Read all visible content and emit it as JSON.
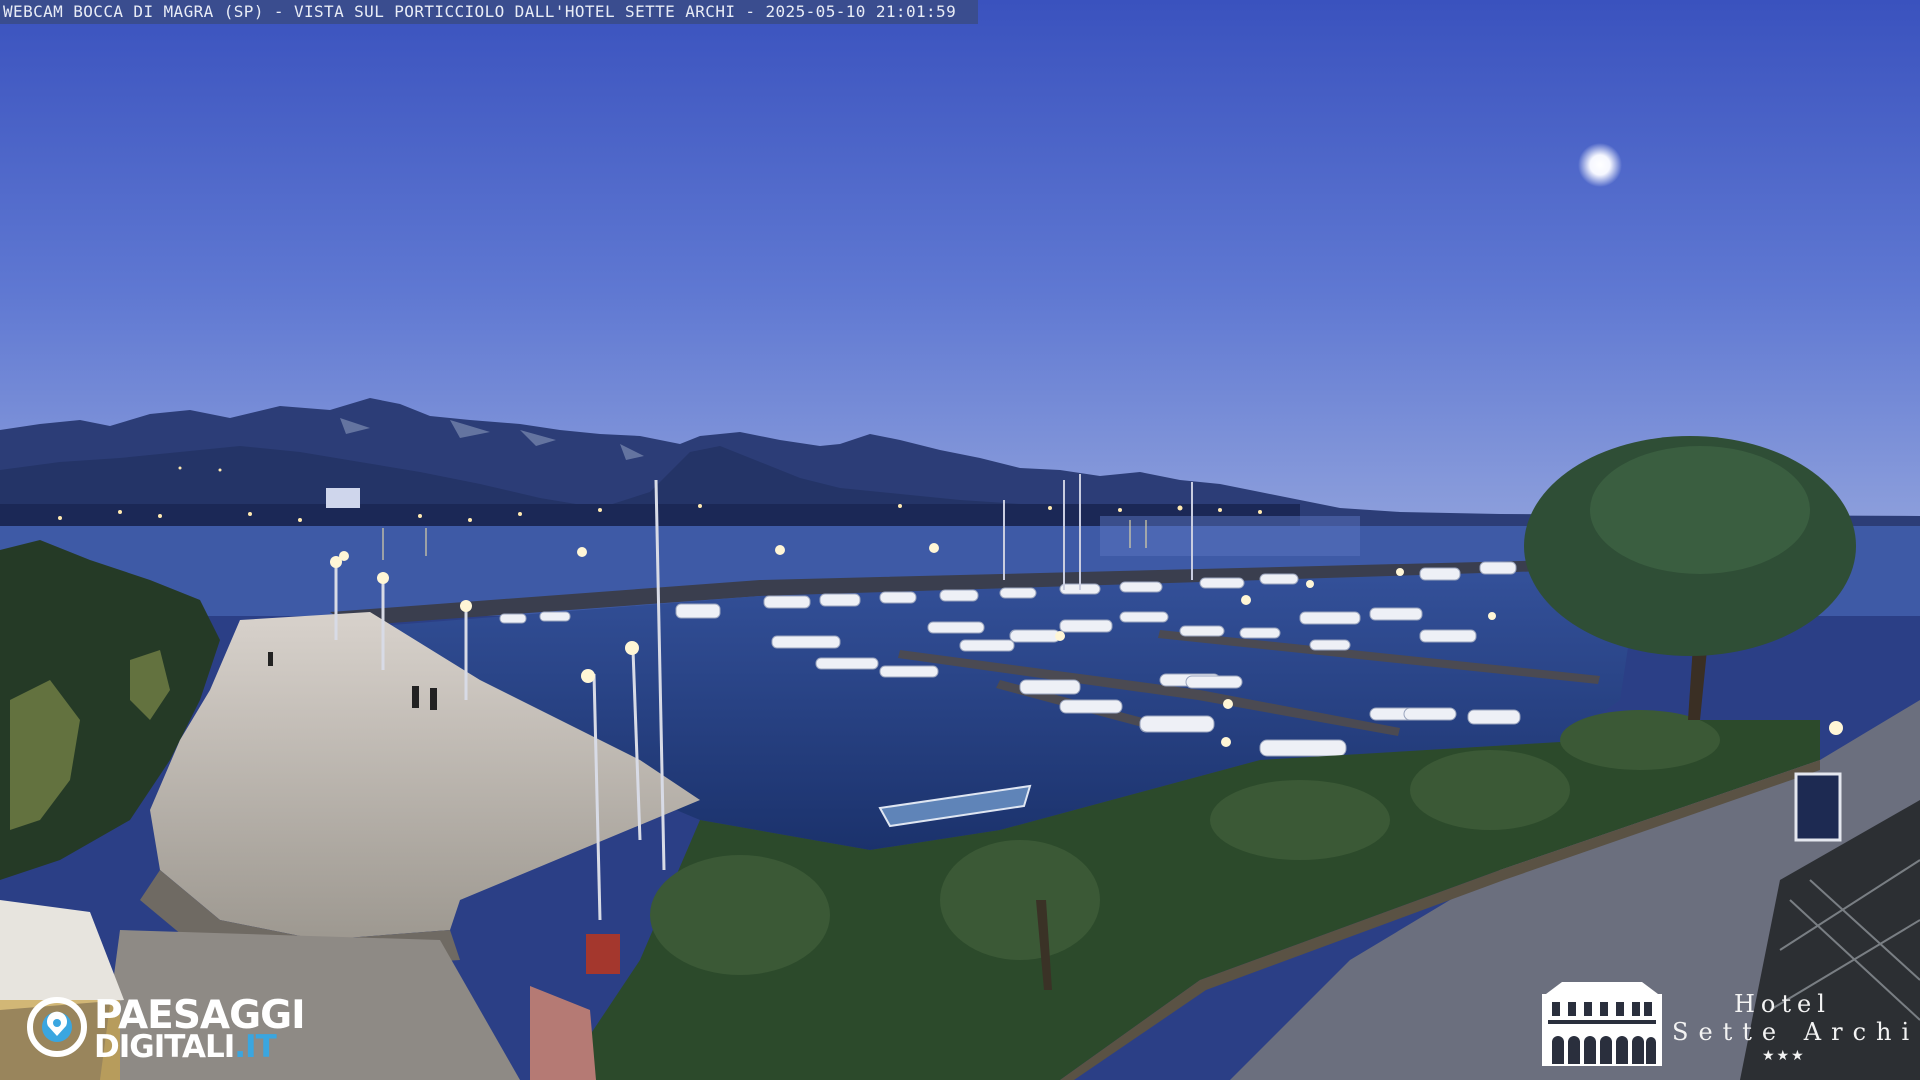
{
  "webcam": {
    "caption": "WEBCAM BOCCA DI MAGRA (SP) - VISTA SUL PORTICCIOLO DALL'HOTEL SETTE ARCHI - 2025-05-10 21:01:59"
  },
  "brand_left": {
    "line1": "PAESAGGI",
    "line2_main": "DIGITALI",
    "line2_suffix": ".IT",
    "logo_icon": "camera-lens-icon"
  },
  "brand_right": {
    "word1": "Hotel",
    "word2": "Sette Archi",
    "stars": "★★★",
    "logo_icon": "hotel-building-icon"
  },
  "colors": {
    "sky_top": "#3b55c0",
    "sky_horizon": "#7f96db",
    "water": "#1f3a78",
    "promenade": "#c9c2bb",
    "lawn": "#2f4a2c",
    "moon": "#ffffff",
    "brand_accent": "#3aa6e0"
  }
}
